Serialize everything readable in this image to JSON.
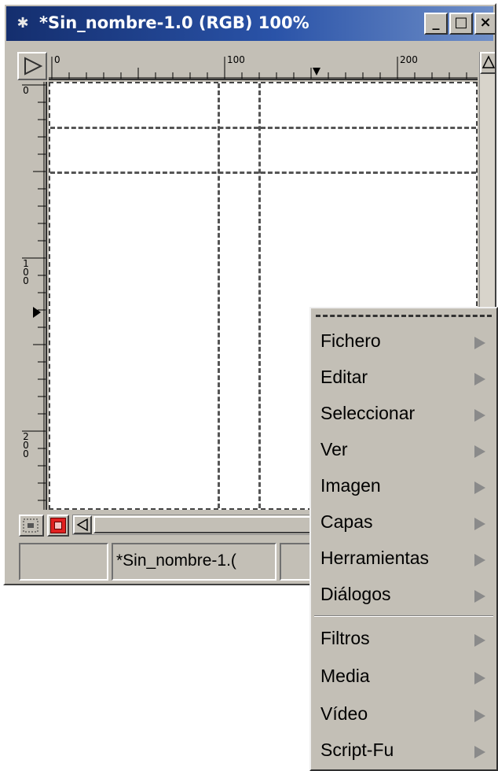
{
  "window": {
    "title": "*Sin_nombre-1.0 (RGB) 100%",
    "app_icon": "wilber-icon",
    "buttons": {
      "minimize": "_",
      "maximize": "□",
      "close": "×"
    }
  },
  "rulers": {
    "horizontal_labels": [
      "0",
      "100",
      "200"
    ],
    "vertical_labels": [
      "0",
      "100",
      "200"
    ]
  },
  "statusbar": {
    "image_name": "*Sin_nombre-1.("
  },
  "context_menu": {
    "items": [
      {
        "label": "Fichero",
        "icon": "submenu-arrow-icon"
      },
      {
        "label": "Editar",
        "icon": "submenu-arrow-icon"
      },
      {
        "label": "Seleccionar",
        "icon": "submenu-arrow-icon"
      },
      {
        "label": "Ver",
        "icon": "submenu-arrow-icon"
      },
      {
        "label": "Imagen",
        "icon": "submenu-arrow-icon"
      },
      {
        "label": "Capas",
        "icon": "submenu-arrow-icon"
      },
      {
        "label": "Herramientas",
        "icon": "submenu-arrow-icon"
      },
      {
        "label": "Diálogos",
        "icon": "submenu-arrow-icon"
      },
      {
        "label": "Filtros",
        "icon": "submenu-arrow-icon"
      },
      {
        "label": "Media",
        "icon": "submenu-arrow-icon"
      },
      {
        "label": "Vídeo",
        "icon": "submenu-arrow-icon"
      },
      {
        "label": "Script-Fu",
        "icon": "submenu-arrow-icon"
      }
    ]
  },
  "colors": {
    "titlebar": "#142e6e",
    "chrome": "#c3bfb6",
    "quick_mask": "#e02020"
  }
}
